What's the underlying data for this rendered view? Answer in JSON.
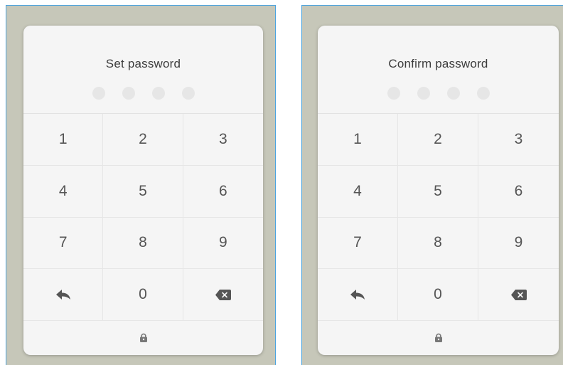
{
  "panels": [
    {
      "title": "Set password",
      "keys": [
        "1",
        "2",
        "3",
        "4",
        "5",
        "6",
        "7",
        "8",
        "9",
        "0"
      ]
    },
    {
      "title": "Confirm password",
      "keys": [
        "1",
        "2",
        "3",
        "4",
        "5",
        "6",
        "7",
        "8",
        "9",
        "0"
      ]
    }
  ],
  "icons": {
    "back": "back-arrow-icon",
    "delete": "backspace-icon",
    "lock": "lock-icon"
  },
  "colors": {
    "background": "#c6c7b9",
    "card": "#f5f5f5",
    "dot": "#e6e6e6",
    "text": "#3c3c3c",
    "border_accent": "#4aa3df"
  }
}
